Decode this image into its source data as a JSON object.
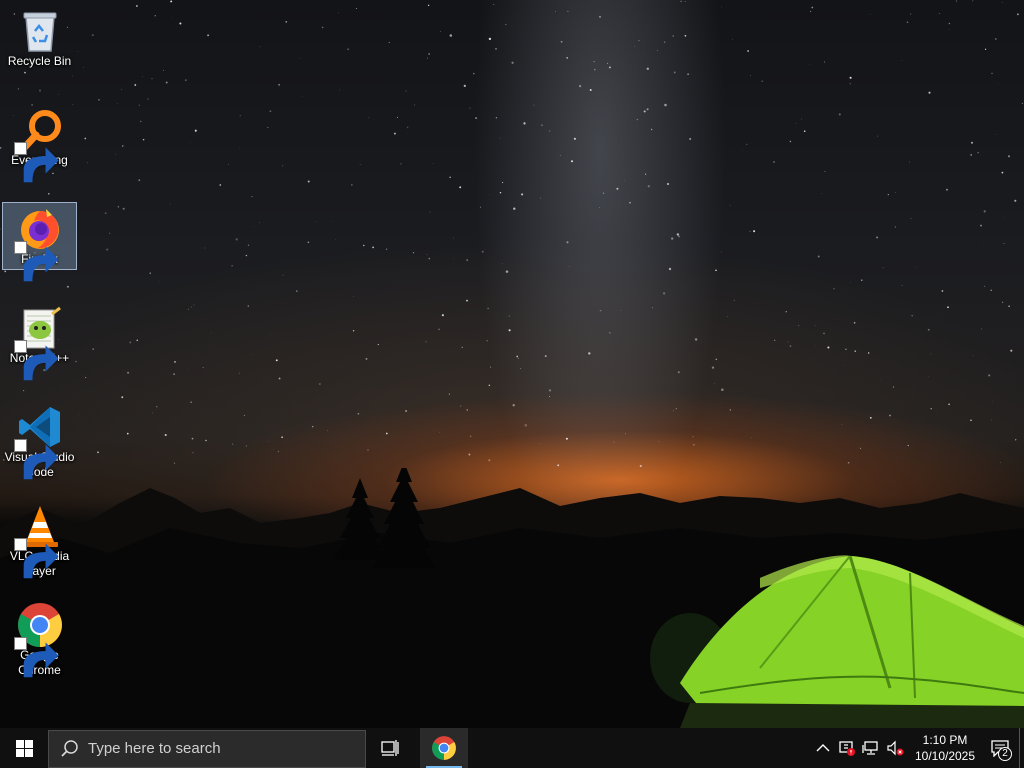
{
  "desktop": {
    "icons": [
      {
        "label": "Recycle Bin",
        "icon": "recycle-bin-icon",
        "selected": false
      },
      {
        "label": "Everything",
        "icon": "everything-search-icon",
        "selected": false
      },
      {
        "label": "Firefox",
        "icon": "firefox-icon",
        "selected": true
      },
      {
        "label": "Notepad++",
        "icon": "notepad-plus-plus-icon",
        "selected": false
      },
      {
        "label": "Visual Studio Code",
        "icon": "vscode-icon",
        "selected": false
      },
      {
        "label": "VLC media player",
        "icon": "vlc-icon",
        "selected": false
      },
      {
        "label": "Google Chrome",
        "icon": "chrome-icon",
        "selected": false
      }
    ]
  },
  "taskbar": {
    "search_placeholder": "Type here to search",
    "pinned_apps": [
      {
        "name": "Google Chrome",
        "icon": "chrome-icon",
        "active": true
      }
    ],
    "tray": {
      "icons": [
        "chevron-up-icon",
        "security-alert-icon",
        "network-icon",
        "volume-muted-icon"
      ],
      "time": "1:10 PM",
      "date": "10/10/2025",
      "notification_count": "2"
    },
    "accent_color": "#76b9ed"
  }
}
